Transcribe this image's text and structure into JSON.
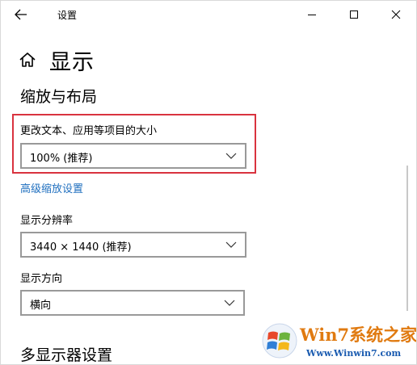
{
  "titlebar": {
    "title": "设置",
    "back_icon": "back-arrow-icon",
    "minimize_icon": "minimize-icon",
    "maximize_icon": "maximize-icon",
    "close_icon": "close-icon"
  },
  "page": {
    "title": "显示",
    "home_icon": "home-icon"
  },
  "scale_layout": {
    "section_title": "缩放与布局",
    "text_size_label": "更改文本、应用等项目的大小",
    "text_size_value": "100% (推荐)",
    "advanced_link": "高级缩放设置",
    "resolution_label": "显示分辨率",
    "resolution_value": "3440 × 1440 (推荐)",
    "orientation_label": "显示方向",
    "orientation_value": "横向"
  },
  "multi_display": {
    "section_title": "多显示器设置"
  },
  "watermark": {
    "line1": "Win7系统之家",
    "line2": "Www.Winwin7.com"
  },
  "colors": {
    "highlight_border": "#d9333f",
    "link": "#1f6fbf",
    "dropdown_border": "#999999"
  }
}
